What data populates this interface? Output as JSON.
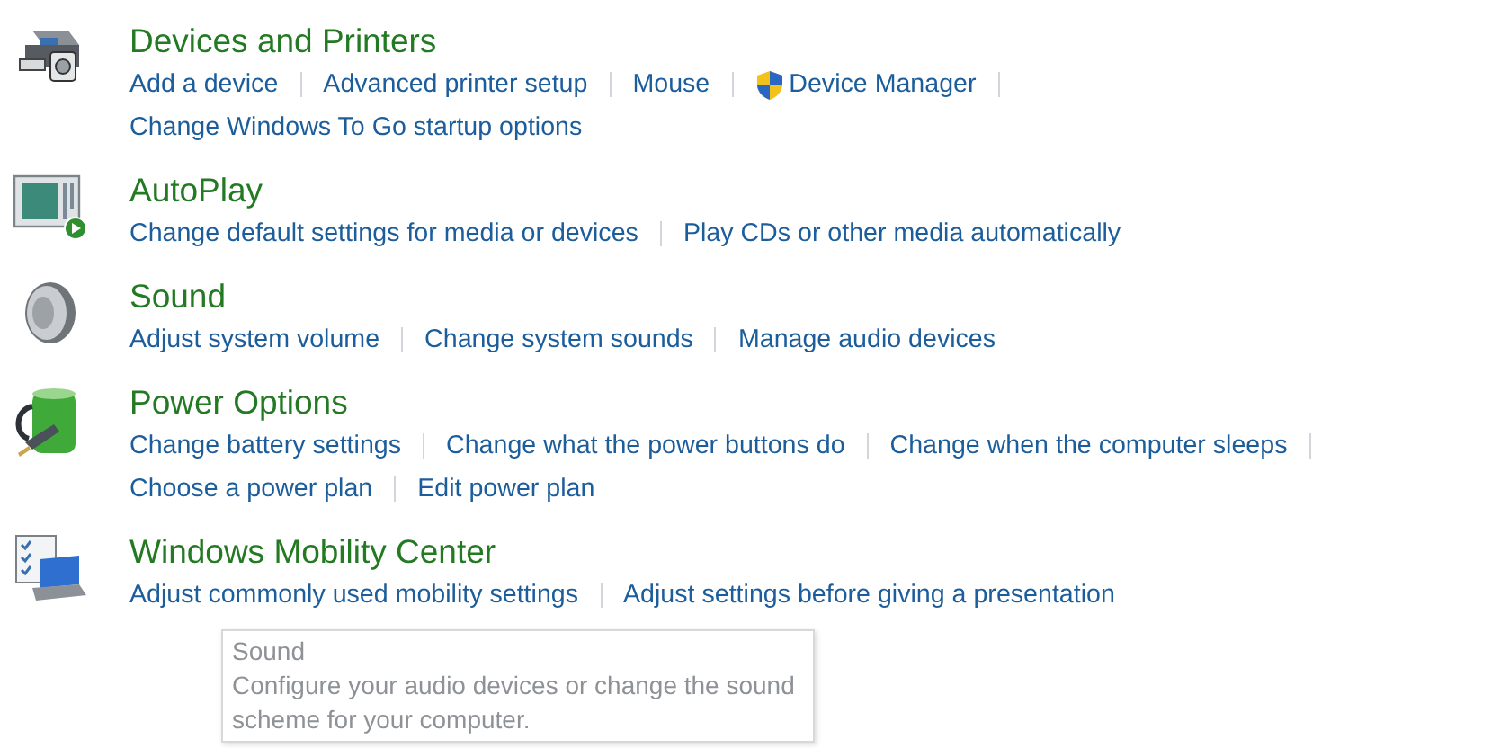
{
  "categories": [
    {
      "kind": "devices",
      "title": "Devices and Printers",
      "lines": [
        [
          {
            "label": "Add a device",
            "admin": false
          },
          {
            "label": "Advanced printer setup",
            "admin": false
          },
          {
            "label": "Mouse",
            "admin": false
          },
          {
            "label": "Device Manager",
            "admin": true
          }
        ],
        [
          {
            "label": "Change Windows To Go startup options",
            "admin": false
          }
        ]
      ]
    },
    {
      "kind": "autoplay",
      "title": "AutoPlay",
      "lines": [
        [
          {
            "label": "Change default settings for media or devices",
            "admin": false
          },
          {
            "label": "Play CDs or other media automatically",
            "admin": false
          }
        ]
      ]
    },
    {
      "kind": "sound",
      "title": "Sound",
      "lines": [
        [
          {
            "label": "Adjust system volume",
            "admin": false
          },
          {
            "label": "Change system sounds",
            "admin": false
          },
          {
            "label": "Manage audio devices",
            "admin": false
          }
        ]
      ]
    },
    {
      "kind": "power",
      "title": "Power Options",
      "lines": [
        [
          {
            "label": "Change battery settings",
            "admin": false
          },
          {
            "label": "Change what the power buttons do",
            "admin": false
          },
          {
            "label": "Change when the computer sleeps",
            "admin": false
          }
        ],
        [
          {
            "label": "Choose a power plan",
            "admin": false
          },
          {
            "label": "Edit power plan",
            "admin": false
          }
        ]
      ]
    },
    {
      "kind": "mobility",
      "title": "Windows Mobility Center",
      "lines": [
        [
          {
            "label": "Adjust commonly used mobility settings",
            "admin": false
          },
          {
            "label": "Adjust settings before giving a presentation",
            "admin": false
          }
        ]
      ]
    }
  ],
  "tooltip": {
    "title": "Sound",
    "text": "Configure your audio devices or change the sound scheme for your computer."
  }
}
